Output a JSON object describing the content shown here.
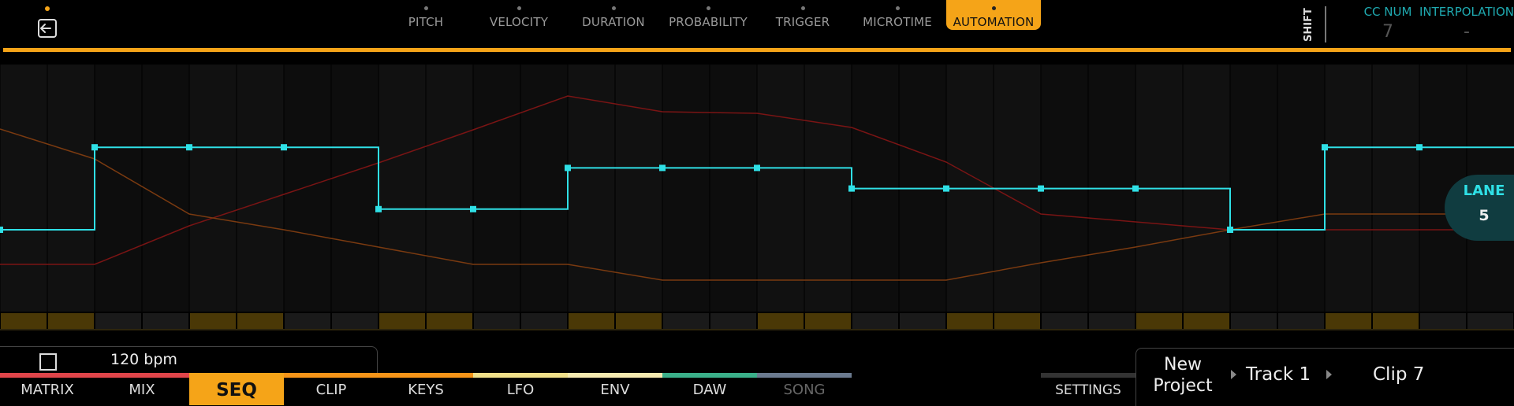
{
  "header": {
    "param_tabs": [
      {
        "label": "PITCH",
        "active": false
      },
      {
        "label": "VELOCITY",
        "active": false
      },
      {
        "label": "DURATION",
        "active": false
      },
      {
        "label": "PROBABILITY",
        "active": false
      },
      {
        "label": "TRIGGER",
        "active": false
      },
      {
        "label": "MICROTIME",
        "active": false
      },
      {
        "label": "AUTOMATION",
        "active": true
      }
    ],
    "shift_label": "SHIFT",
    "cc_num": {
      "label": "CC NUM",
      "value": "7"
    },
    "interpolation": {
      "label": "INTERPOLATION",
      "value": "-"
    }
  },
  "automation": {
    "steps": 32,
    "active_lane_values": [
      0.0,
      0.0,
      0.8,
      0.8,
      0.8,
      0.8,
      0.8,
      0.8,
      0.2,
      0.2,
      0.2,
      0.2,
      0.6,
      0.6,
      0.6,
      0.6,
      0.6,
      0.6,
      0.4,
      0.4,
      0.4,
      0.4,
      0.4,
      0.4,
      0.4,
      0.4,
      0.0,
      0.0,
      0.8,
      0.8,
      0.8,
      0.8
    ],
    "lane_label": "LANE",
    "lane_number": "5",
    "colors": {
      "active_lane": "#2fe0e6",
      "ghost_lane_red": "#7a1414",
      "ghost_lane_orange": "#7a3a10",
      "step_on": "#4a3806",
      "step_off": "#1a1a1a"
    }
  },
  "transport": {
    "stop_icon": "stop-square-icon",
    "bpm": "120 bpm"
  },
  "nav": {
    "tabs": [
      {
        "label": "MATRIX",
        "color": "#e0454a",
        "active": false
      },
      {
        "label": "MIX",
        "color": "#e0454a",
        "active": false
      },
      {
        "label": "SEQ",
        "color": "#f5a418",
        "active": true
      },
      {
        "label": "CLIP",
        "color": "#f59418",
        "active": false
      },
      {
        "label": "KEYS",
        "color": "#f59418",
        "active": false
      },
      {
        "label": "LFO",
        "color": "#f0e08a",
        "active": false
      },
      {
        "label": "ENV",
        "color": "#f5eab0",
        "active": false
      },
      {
        "label": "DAW",
        "color": "#3bb08a",
        "active": false
      },
      {
        "label": "SONG",
        "color": "#6b7a8f",
        "active": false,
        "disabled": true
      }
    ],
    "settings_label": "SETTINGS"
  },
  "breadcrumb": {
    "project": "New Project",
    "track": "Track 1",
    "clip": "Clip 7"
  }
}
